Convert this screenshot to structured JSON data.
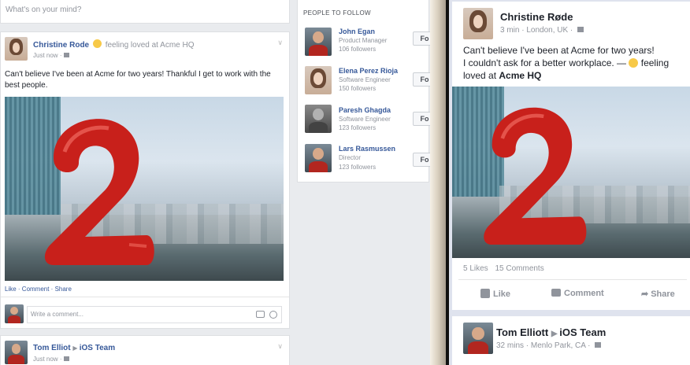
{
  "left_feed": {
    "composer_placeholder": "What's on your mind?",
    "post1": {
      "author": "Christine Rode",
      "feeling": "feeling loved at Acme HQ",
      "time": "Just now",
      "text": "Can't believe I've been at Acme for two years! Thankful I get to work with the best people.",
      "actions": "Like · Comment · Share",
      "comment_placeholder": "Write a comment..."
    },
    "post2": {
      "author": "Tom Elliot",
      "group": "iOS Team",
      "time": "Just now"
    }
  },
  "people_to_follow": {
    "heading": "PEOPLE TO FOLLOW",
    "button_label": "Fo",
    "people": [
      {
        "name": "John Egan",
        "title": "Product Manager",
        "followers": "106 followers"
      },
      {
        "name": "Elena Perez Rioja",
        "title": "Software Engineer",
        "followers": "150 followers"
      },
      {
        "name": "Paresh Ghagda",
        "title": "Software Engineer",
        "followers": "123 followers"
      },
      {
        "name": "Lars Rasmussen",
        "title": "Director",
        "followers": "123 followers"
      }
    ]
  },
  "mobile": {
    "post1": {
      "author": "Christine Røde",
      "time": "3 min · London, UK ·",
      "text_line1": "Can't believe I've been at Acme for two years!",
      "text_line2": "I couldn't ask for a better workplace. —",
      "text_line3_pre": "feeling",
      "text_line4_pre": "loved at",
      "text_line4_bold": "Acme HQ",
      "likes": "5 Likes",
      "comments": "15 Comments",
      "like_label": "Like",
      "comment_label": "Comment",
      "share_label": "Share"
    },
    "post2": {
      "author": "Tom Elliott",
      "group": "iOS Team",
      "time": "32 mins · Menlo Park, CA ·"
    }
  },
  "colors": {
    "link": "#365899",
    "background": "#e9ebee",
    "balloon": "#c8201b"
  }
}
